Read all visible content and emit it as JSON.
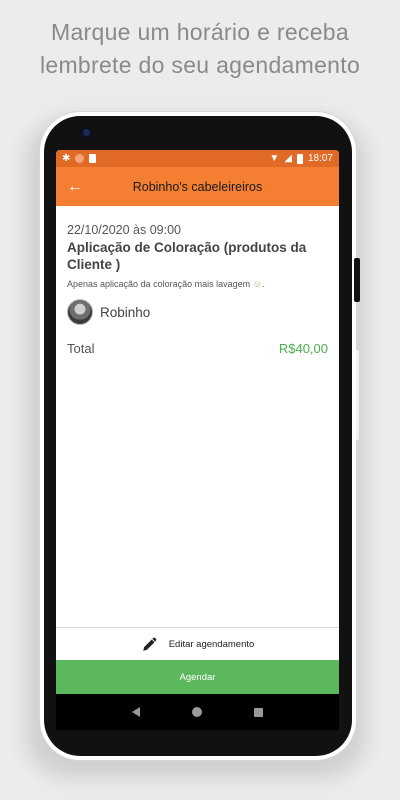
{
  "headline": {
    "line1": "Marque um horário e receba",
    "line2": "lembrete do seu agendamento"
  },
  "status_bar": {
    "time": "18:07"
  },
  "app_bar": {
    "title": "Robinho's cabeleireiros",
    "back_icon": "arrow-left-icon"
  },
  "appointment": {
    "datetime": "22/10/2020 às 09:00",
    "service": "Aplicação de Coloração (produtos da Cliente )",
    "description": "Apenas aplicação da coloração mais lavagem",
    "professional": "Robinho"
  },
  "total": {
    "label": "Total",
    "value": "R$40,00"
  },
  "actions": {
    "edit_label": "Editar agendamento",
    "schedule_label": "Agendar"
  },
  "colors": {
    "status_bar": "#e06a26",
    "app_bar": "#f47f32",
    "price": "#4cae4c",
    "schedule_button": "#5cb85c"
  }
}
